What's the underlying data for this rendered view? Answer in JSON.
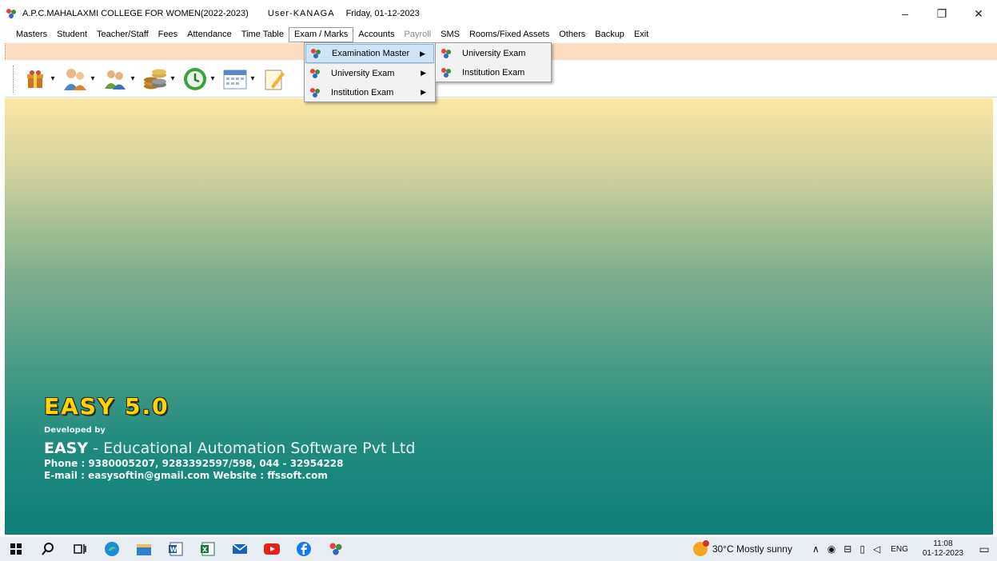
{
  "window": {
    "title": "A.P.C.MAHALAXMI COLLEGE FOR WOMEN(2022-2023)",
    "user": "User-KANAGA",
    "date": "Friday, 01-12-2023",
    "controls": {
      "minimize": "–",
      "restore": "❐",
      "close": "✕"
    }
  },
  "menubar": [
    "Masters",
    "Student",
    "Teacher/Staff",
    "Fees",
    "Attendance",
    "Time Table",
    "Exam / Marks",
    "Accounts",
    "Payroll",
    "SMS",
    "Rooms/Fixed Assets",
    "Others",
    "Backup",
    "Exit"
  ],
  "menu_state": {
    "active": "Exam / Marks",
    "disabled": "Payroll"
  },
  "exam_menu": {
    "items": [
      "Examination Master",
      "University Exam",
      "Institution Exam"
    ]
  },
  "examination_master_submenu": {
    "items": [
      "University Exam",
      "Institution Exam"
    ]
  },
  "toolbar_icons": [
    "gift-icon",
    "teacher-icon",
    "students-icon",
    "coins-icon",
    "clock-icon",
    "calendar-icon",
    "notepad-icon"
  ],
  "branding": {
    "product": "EASY 5.0",
    "developed_by": "Developed by",
    "company_strong": "EASY",
    "company_rest": " - Educational Automation Software Pvt Ltd",
    "phone": "Phone : 9380005207, 9283392597/598,  044 - 32954228",
    "email_line": "E-mail : easysoftin@gmail.com     Website : ffssoft.com"
  },
  "taskbar": {
    "apps": [
      "windows-start-icon",
      "search-icon",
      "task-view-icon",
      "edge-icon",
      "file-explorer-icon",
      "word-icon",
      "excel-icon",
      "mail-icon",
      "youtube-icon",
      "facebook-icon",
      "easy-app-icon"
    ],
    "weather": "30°C  Mostly sunny",
    "language": "ENG",
    "time": "11:08",
    "date": "01-12-2023"
  },
  "colors": {
    "peach_strip": "#fcdcc2",
    "brand_yellow": "#ffd400",
    "menu_highlight": "#cfe4f7"
  }
}
